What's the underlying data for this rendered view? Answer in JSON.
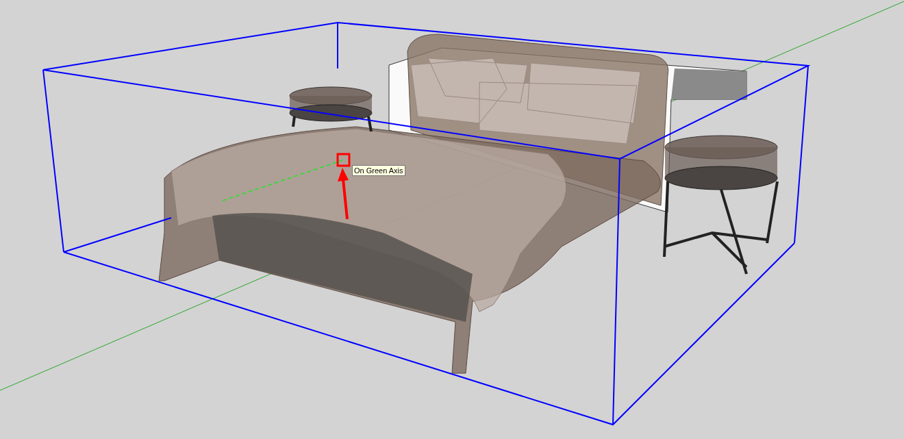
{
  "viewport": {
    "tooltip": "On Green Axis"
  }
}
